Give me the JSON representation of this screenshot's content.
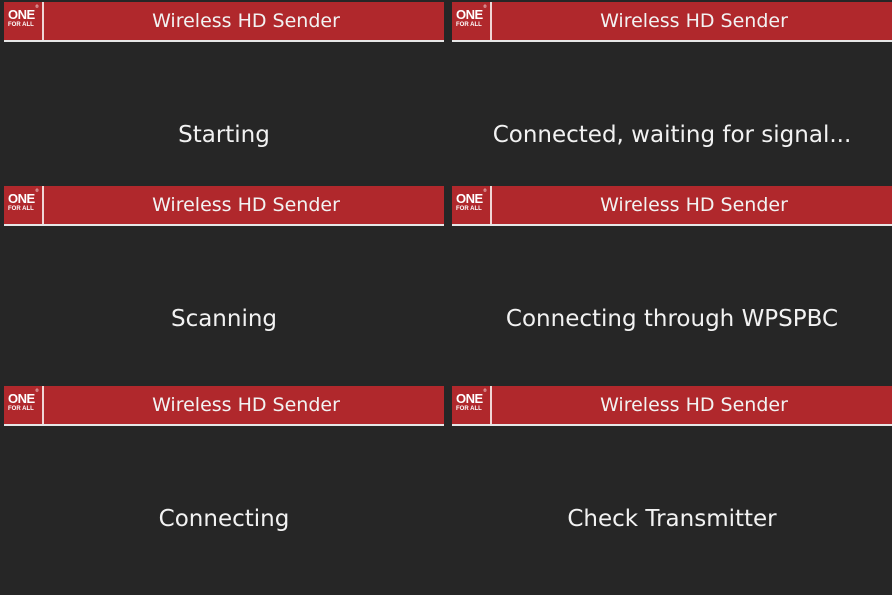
{
  "logo": {
    "line1": "ONE",
    "line2": "FOR ALL",
    "registered": "®"
  },
  "colors": {
    "background": "#262626",
    "header": "#b0282c",
    "text": "#f2f2f2"
  },
  "screens": [
    {
      "title": "Wireless HD Sender",
      "status": "Starting"
    },
    {
      "title": "Wireless HD Sender",
      "status": "Connected, waiting for signal..."
    },
    {
      "title": "Wireless HD Sender",
      "status": "Scanning"
    },
    {
      "title": "Wireless HD Sender",
      "status": "Connecting through WPSPBC"
    },
    {
      "title": "Wireless HD Sender",
      "status": "Connecting"
    },
    {
      "title": "Wireless HD Sender",
      "status": "Check Transmitter"
    }
  ]
}
